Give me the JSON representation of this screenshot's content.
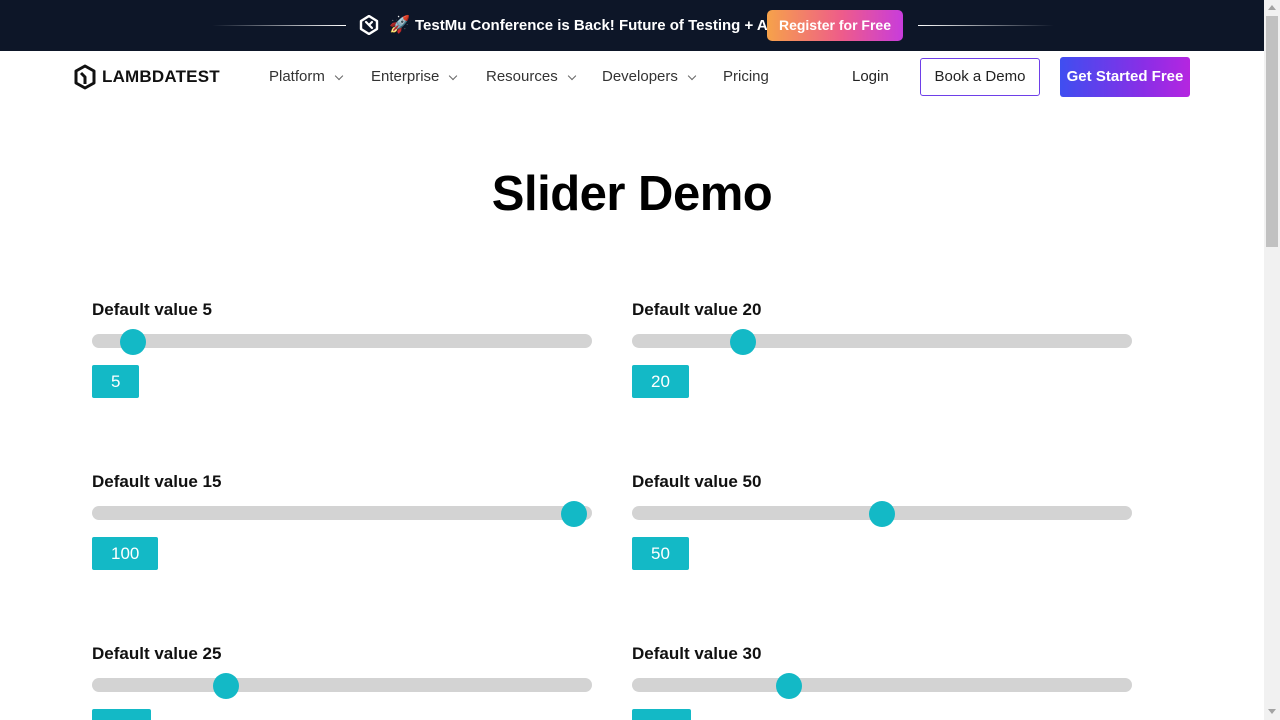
{
  "banner": {
    "rocket_icon": "rocket-icon",
    "text": "TestMu Conference is Back! Future of Testing + AI",
    "register_label": "Register for Free"
  },
  "nav": {
    "brand": "LAMBDATEST",
    "items": [
      {
        "label": "Platform",
        "has_dropdown": true
      },
      {
        "label": "Enterprise",
        "has_dropdown": true
      },
      {
        "label": "Resources",
        "has_dropdown": true
      },
      {
        "label": "Developers",
        "has_dropdown": true
      },
      {
        "label": "Pricing",
        "has_dropdown": false
      }
    ],
    "login": "Login",
    "book_demo": "Book a Demo",
    "get_started": "Get Started Free"
  },
  "page": {
    "title": "Slider Demo"
  },
  "sliders": [
    {
      "label": "Default value 5",
      "value": "5",
      "min": 0,
      "max": 100,
      "current": 5
    },
    {
      "label": "Default value 20",
      "value": "20",
      "min": 0,
      "max": 100,
      "current": 20
    },
    {
      "label": "Default value 15",
      "value": "100",
      "min": 0,
      "max": 100,
      "current": 100
    },
    {
      "label": "Default value 50",
      "value": "50",
      "min": 0,
      "max": 100,
      "current": 50
    },
    {
      "label": "Default value 25",
      "value": "",
      "min": 0,
      "max": 100,
      "current": 25
    },
    {
      "label": "Default value 30",
      "value": "",
      "min": 0,
      "max": 100,
      "current": 30
    }
  ],
  "colors": {
    "banner_bg": "#0d1628",
    "accent": "#13b9c6",
    "track": "#d3d3d3",
    "cta_gradient_start": "#3f4ef0",
    "cta_gradient_end": "#b526e0"
  }
}
